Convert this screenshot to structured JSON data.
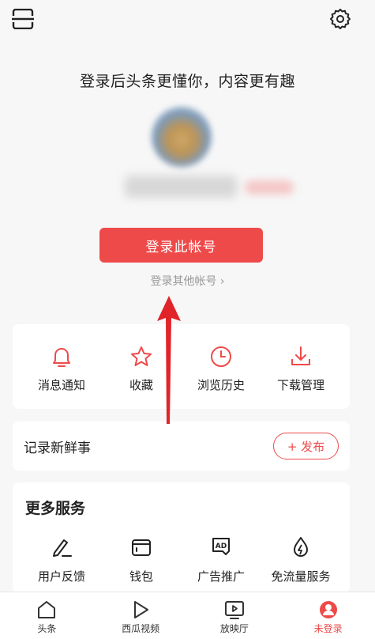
{
  "header": {
    "scan_icon": "scan-icon",
    "settings_icon": "gear-icon"
  },
  "profile": {
    "headline": "登录后头条更懂你，内容更有趣",
    "login_button": "登录此帐号",
    "other_login": "登录其他帐号 ›"
  },
  "quick_actions": [
    {
      "label": "消息通知",
      "icon": "bell-icon"
    },
    {
      "label": "收藏",
      "icon": "star-icon"
    },
    {
      "label": "浏览历史",
      "icon": "clock-icon"
    },
    {
      "label": "下载管理",
      "icon": "download-icon"
    }
  ],
  "record": {
    "label": "记录新鲜事",
    "post_button": "+ 发布"
  },
  "services": {
    "title": "更多服务",
    "items": [
      {
        "label": "用户反馈",
        "icon": "pen-icon"
      },
      {
        "label": "钱包",
        "icon": "wallet-icon"
      },
      {
        "label": "广告推广",
        "icon": "ad-icon"
      },
      {
        "label": "免流量服务",
        "icon": "data-drop-icon"
      }
    ]
  },
  "bottom_nav": [
    {
      "label": "头条",
      "icon": "home-icon"
    },
    {
      "label": "西瓜视频",
      "icon": "play-icon"
    },
    {
      "label": "放映厅",
      "icon": "tv-play-icon"
    },
    {
      "label": "未登录",
      "icon": "profile-icon"
    }
  ],
  "colors": {
    "accent": "#ef4a4a",
    "background": "#f7f7f7",
    "card": "#ffffff"
  }
}
